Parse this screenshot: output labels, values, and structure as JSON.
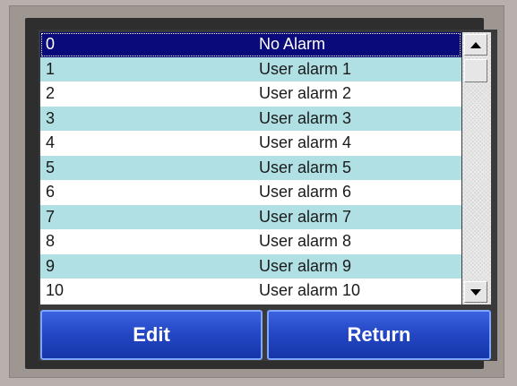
{
  "alarms": [
    {
      "num": "0",
      "label": "No Alarm"
    },
    {
      "num": "1",
      "label": "User alarm 1"
    },
    {
      "num": "2",
      "label": "User alarm 2"
    },
    {
      "num": "3",
      "label": "User alarm 3"
    },
    {
      "num": "4",
      "label": "User alarm 4"
    },
    {
      "num": "5",
      "label": "User alarm 5"
    },
    {
      "num": "6",
      "label": "User alarm 6"
    },
    {
      "num": "7",
      "label": "User alarm 7"
    },
    {
      "num": "8",
      "label": "User alarm 8"
    },
    {
      "num": "9",
      "label": "User alarm 9"
    },
    {
      "num": "10",
      "label": "User alarm 10"
    }
  ],
  "selected_index": 0,
  "buttons": {
    "edit_label": "Edit",
    "return_label": "Return"
  },
  "colors": {
    "row_alt": "#b0e0e4",
    "row_selected": "#0a0a7a",
    "button_blue": "#2448c6"
  },
  "icons": {
    "scroll_up": "triangle-up-icon",
    "scroll_down": "triangle-down-icon"
  }
}
